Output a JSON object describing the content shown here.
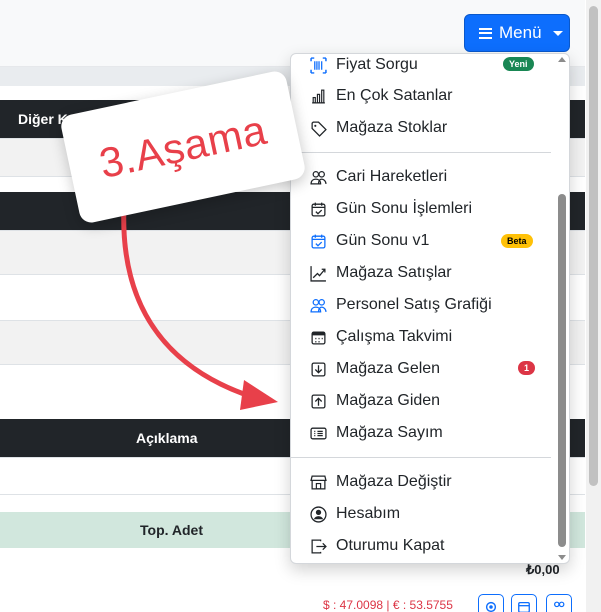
{
  "header": {
    "menu_label": "Menü"
  },
  "table": {
    "header1": "Diğer Kanal Satış",
    "header2": "Açıklama",
    "footer_label": "Top. Adet",
    "total": "₺0,00",
    "rates": "$ : 47.0098 | € : 53.5755"
  },
  "dropdown": {
    "items": [
      {
        "label": "Fiyat Sorgu",
        "icon": "barcode-icon",
        "badge": "Yeni"
      },
      {
        "label": "En Çok Satanlar",
        "icon": "bar-chart-icon"
      },
      {
        "label": "Mağaza Stoklar",
        "icon": "tag-icon"
      },
      {
        "label": "Cari Hareketleri",
        "icon": "people-icon"
      },
      {
        "label": "Gün Sonu İşlemleri",
        "icon": "calendar-check-icon"
      },
      {
        "label": "Gün Sonu v1",
        "icon": "calendar-check-icon",
        "badge": "Beta"
      },
      {
        "label": "Mağaza Satışlar",
        "icon": "graph-up-icon"
      },
      {
        "label": "Personel Satış Grafiği",
        "icon": "people-icon"
      },
      {
        "label": "Çalışma Takvimi",
        "icon": "calendar-week-icon"
      },
      {
        "label": "Mağaza Gelen",
        "icon": "box-arrow-in-down-icon",
        "badge": "1"
      },
      {
        "label": "Mağaza Giden",
        "icon": "box-arrow-up-icon"
      },
      {
        "label": "Mağaza Sayım",
        "icon": "card-list-icon"
      },
      {
        "label": "Mağaza Değiştir",
        "icon": "shop-icon"
      },
      {
        "label": "Hesabım",
        "icon": "person-circle-icon"
      },
      {
        "label": "Oturumu Kapat",
        "icon": "box-arrow-right-icon"
      }
    ]
  },
  "annotation": {
    "text": "3.Aşama"
  },
  "colors": {
    "primary": "#0d6efd",
    "dark_header": "#212529",
    "annotation": "#e8404a",
    "badge_new": "#198754",
    "badge_beta": "#ffc107",
    "badge_count": "#dc3545"
  }
}
